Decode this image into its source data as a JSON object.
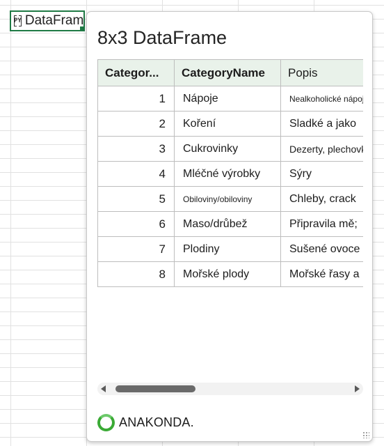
{
  "cell": {
    "icon": "python-icon",
    "icon_text": "PY",
    "text": "DataFrame"
  },
  "card": {
    "title": "8x3 DataFrame",
    "columns": [
      "Categor...",
      "CategoryName",
      "Popis"
    ],
    "rows": [
      {
        "id": "1",
        "name": "Nápoje",
        "popis": "Nealkoholické nápoje, c"
      },
      {
        "id": "2",
        "name": "Koření",
        "popis": "Sladké a jako"
      },
      {
        "id": "3",
        "name": "Cukrovinky",
        "popis": "Dezerty, plechovky"
      },
      {
        "id": "4",
        "name": "Mléčné výrobky",
        "popis": "Sýry"
      },
      {
        "id": "5",
        "name": "Obiloviny/obiloviny",
        "popis": "Chleby, crack"
      },
      {
        "id": "6",
        "name": "Maso/drůbež",
        "popis": "Připravila mě;"
      },
      {
        "id": "7",
        "name": "Plodiny",
        "popis": "Sušené ovoce an"
      },
      {
        "id": "8",
        "name": "Mořské plody",
        "popis": "Mořské řasy a"
      }
    ],
    "footer_brand": "ANAKONDA."
  },
  "colors": {
    "selection_border": "#1f7a45",
    "header_bg": "#e9f2ea",
    "brand_ring": "#3aaa35"
  }
}
